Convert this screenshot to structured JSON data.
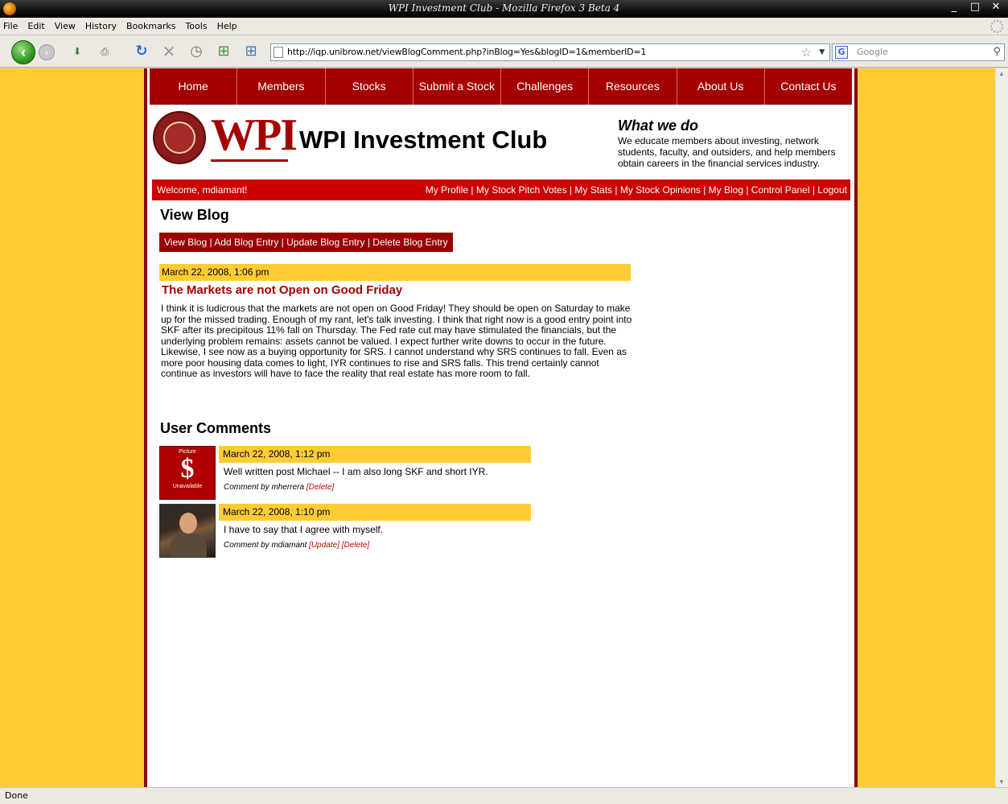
{
  "window": {
    "title": "WPI Investment Club - Mozilla Firefox 3 Beta 4",
    "min": "_",
    "max": "□",
    "close": "✕"
  },
  "menu": [
    "File",
    "Edit",
    "View",
    "History",
    "Bookmarks",
    "Tools",
    "Help"
  ],
  "toolbar": {
    "url": "http://iqp.unibrow.net/viewBlogComment.php?inBlog=Yes&blogID=1&memberID=1",
    "search_placeholder": "Google"
  },
  "site": {
    "nav": [
      "Home",
      "Members",
      "Stocks",
      "Submit a Stock",
      "Challenges",
      "Resources",
      "About Us",
      "Contact Us"
    ],
    "logo_text": "WPI",
    "club_title": "WPI Investment Club",
    "what_we_do": {
      "heading": "What we do",
      "text": "We educate members about investing, network students, faculty, and outsiders, and help members obtain careers in the financial services industry."
    },
    "welcome": "Welcome, mdiamant!",
    "user_links": "My Profile | My Stock Pitch Votes | My Stats | My Stock Opinions | My Blog | Control Panel | Logout"
  },
  "blog": {
    "heading": "View Blog",
    "tabs": "View Blog | Add Blog Entry | Update Blog Entry | Delete Blog Entry",
    "entry": {
      "date": "March 22, 2008, 1:06 pm",
      "title": "The Markets are not Open on Good Friday",
      "body": "I think it is ludicrous that the markets are not open on Good Friday! They should be open on Saturday to make up for the missed trading. Enough of my rant, let's talk investing. I think that right now is a good entry point into SKF after its precipitous 11% fall on Thursday. The Fed rate cut may have stimulated the financials, but the underlying problem remains: assets cannot be valued. I expect further write downs to occur in the future. Likewise, I see now as a buying opportunity for SRS. I cannot understand why SRS continues to fall. Even as more poor housing data comes to light, IYR continues to rise and SRS falls. This trend certainly cannot continue as investors will have to face the reality that real estate has more room to fall."
    },
    "comments_heading": "User Comments",
    "comments": [
      {
        "date": "March 22, 2008, 1:12 pm",
        "text": "Well written post Michael -- I am also long SKF and short IYR.",
        "by": "Comment by mherrera",
        "delete": "[Delete]",
        "avatar_top": "Picture",
        "avatar_symbol": "$",
        "avatar_bottom": "Unavailable"
      },
      {
        "date": "March 22, 2008, 1:10 pm",
        "text": "I have to say that I agree with myself.",
        "by": "Comment by mdiamant",
        "update": "[Update]",
        "delete": "[Delete]"
      }
    ]
  },
  "status": "Done"
}
